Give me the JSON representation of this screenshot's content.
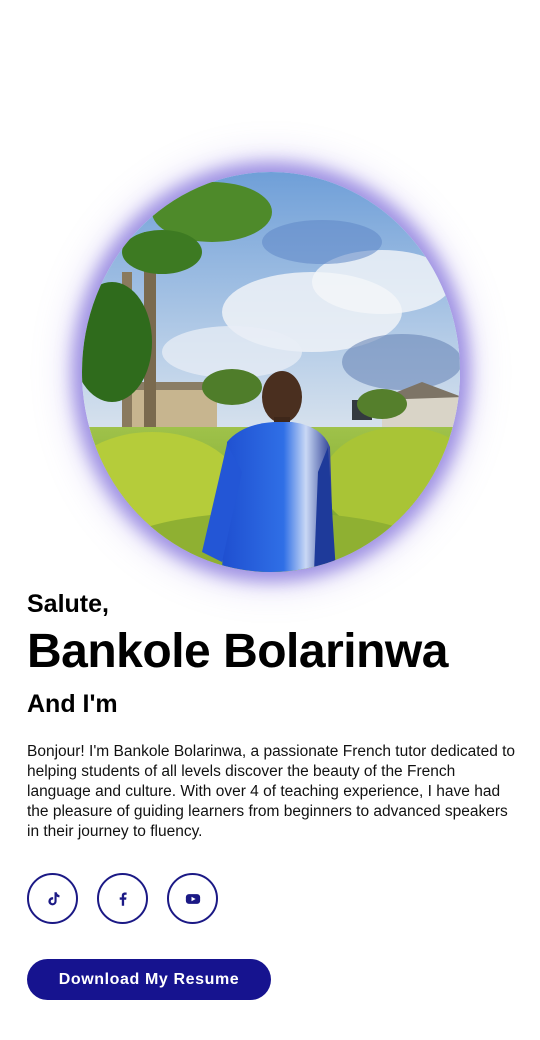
{
  "profile": {
    "greeting": "Salute,",
    "name": "Bankole Bolarinwa",
    "subtitle": "And I'm",
    "bio": "Bonjour! I'm Bankole Bolarinwa, a passionate French tutor dedicated to helping students of all levels discover the beauty of the French language and culture. With over 4 of teaching experience, I have had the pleasure of guiding learners from beginners to advanced speakers in their journey to fluency."
  },
  "socials": [
    {
      "icon": "tiktok-icon"
    },
    {
      "icon": "facebook-icon"
    },
    {
      "icon": "youtube-icon"
    }
  ],
  "actions": {
    "resume_label": "Download My Resume"
  },
  "colors": {
    "accent": "#16138f",
    "glow": "#6a52d6",
    "text": "#000000",
    "background": "#ffffff"
  }
}
